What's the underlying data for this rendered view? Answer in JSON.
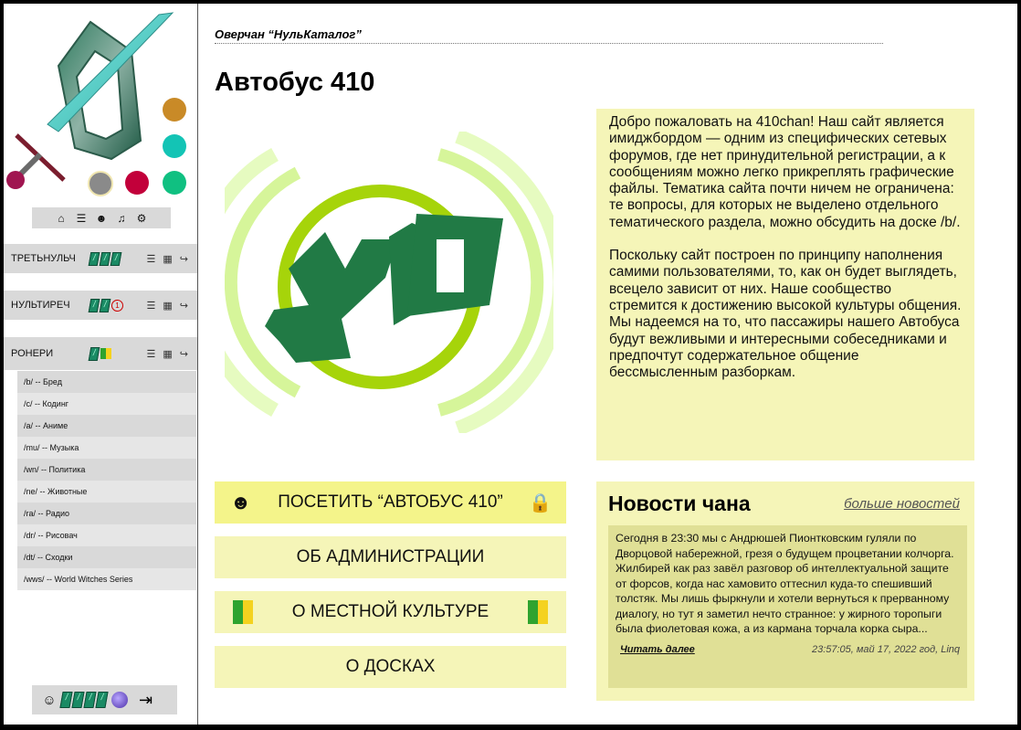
{
  "site": {
    "name": "Оверчан “НульКаталог”",
    "page_title": "Автобус 410"
  },
  "sidebar": {
    "iconbar": [
      "home-icon",
      "database-icon",
      "mask-icon",
      "music-icon",
      "settings-icon"
    ],
    "color_dots": [
      "#c98a27",
      "#13c4b5",
      "#8a8a8a",
      "#c2003a",
      "#10c081"
    ],
    "groups": [
      {
        "name": "ТРЕТЬНУЛЬЧ",
        "tags": [
          "/",
          "/",
          "/"
        ]
      },
      {
        "name": "НУЛЬТИРЕЧ",
        "tags": [
          "/",
          "/"
        ],
        "badge": "1"
      },
      {
        "name": "РОНЕРИ",
        "tags": [
          "/"
        ]
      }
    ],
    "boards": [
      "/b/ -- Бред",
      "/c/ -- Кодинг",
      "/a/ -- Аниме",
      "/mu/ -- Музыка",
      "/wn/ -- Политика",
      "/ne/ -- Животные",
      "/ra/ -- Радио",
      "/dr/ -- Рисовач",
      "/dt/ -- Сходки",
      "/wws/ -- World Witches Series"
    ],
    "user_tags": [
      "/",
      "/",
      "/",
      "/"
    ]
  },
  "logo": {
    "text": "410"
  },
  "welcome": {
    "p1": "Добро пожаловать на 410chan! Наш сайт является имиджбордом — одним из специфических сетевых форумов, где нет принудительной регистрации, а к сообщениям можно легко прикреплять графические файлы. Тематика сайта почти ничем не ограничена: те вопросы, для которых не выделено отдельного тематического раздела, можно обсудить на доске /b/.",
    "p2": "Поскольку сайт построен по принципу наполнения самими пользователями, то, как он будет выглядеть, всецело зависит от них. Наше сообщество стремится к достижению высокой культуры общения. Мы надеемся на то, что пассажиры нашего Автобуса будут вежливыми и интересными собеседниками и предпочтут содержательное общение бессмысленным разборкам."
  },
  "nav": {
    "visit": "ПОСЕТИТЬ “АВТОБУС 410”",
    "admin": "ОБ АДМИНИСТРАЦИИ",
    "culture": "О МЕСТНОЙ КУЛЬТУРЕ",
    "boards": "О ДОСКАХ"
  },
  "news": {
    "title": "Новости чана",
    "more": "больше новостей",
    "body": "Сегодня в 23:30 мы с Андрюшей Пионтковским гуляли по Дворцовой набережной, грезя о будущем процветании колчорга. Жилбирей как раз завёл разговор об интеллектуальной защите от форсов, когда нас хамовито оттеснил куда-то спешивший толстяк. Мы лишь фыркнули и хотели вернуться к прерванному диалогу, но тут я заметил нечто странное: у жирного торопыги была фиолетовая кожа, а из кармана торчала корка сыра...",
    "read_more": "Читать далее",
    "meta": "23:57:05, май 17, 2022 год, Linq"
  }
}
